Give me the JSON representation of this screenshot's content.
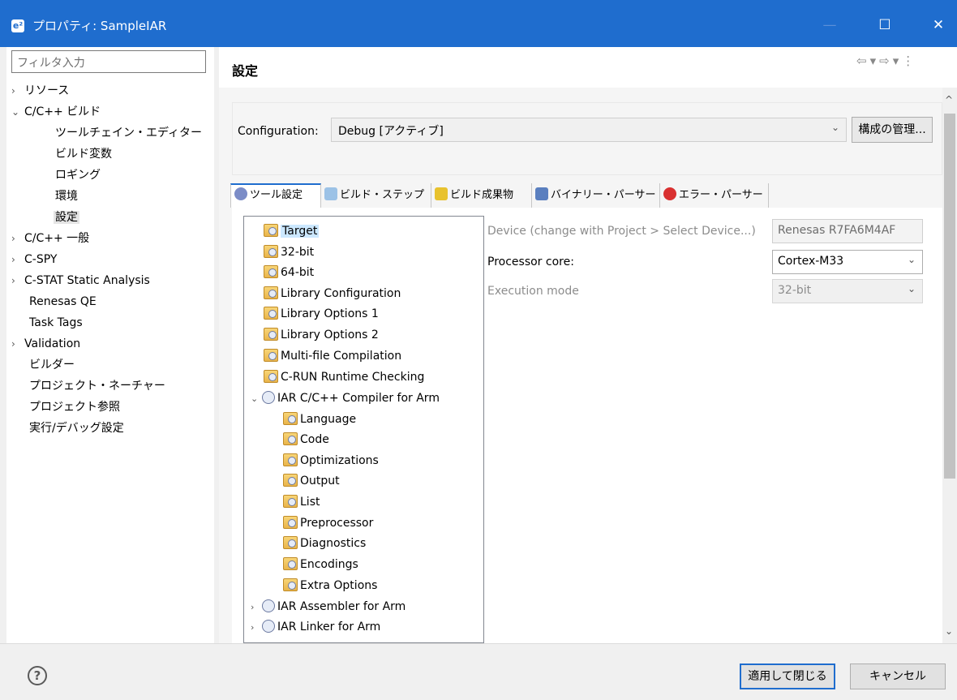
{
  "window": {
    "title": "プロパティ: SampleIAR",
    "app_icon": "e²",
    "minimize_icon": "—",
    "maximize_icon": "☐",
    "close_icon": "✕"
  },
  "filter": {
    "placeholder": "フィルタ入力"
  },
  "nav": {
    "items": [
      {
        "label": "リソース",
        "twisty": "›"
      },
      {
        "label": "C/C++ ビルド",
        "twisty": "⌄"
      },
      {
        "label": "ツールチェイン・エディター"
      },
      {
        "label": "ビルド変数"
      },
      {
        "label": "ロギング"
      },
      {
        "label": "環境"
      },
      {
        "label": "設定"
      },
      {
        "label": "C/C++ 一般",
        "twisty": "›"
      },
      {
        "label": "C-SPY",
        "twisty": "›"
      },
      {
        "label": "C-STAT Static Analysis",
        "twisty": "›"
      },
      {
        "label": "Renesas QE"
      },
      {
        "label": "Task Tags"
      },
      {
        "label": "Validation",
        "twisty": "›"
      },
      {
        "label": "ビルダー"
      },
      {
        "label": "プロジェクト・ネーチャー"
      },
      {
        "label": "プロジェクト参照"
      },
      {
        "label": "実行/デバッグ設定"
      }
    ]
  },
  "page": {
    "title": "設定",
    "back_icon": "⇦",
    "forward_icon": "⇨",
    "dropdown_icon": "▾",
    "menu_icon": "⋮"
  },
  "config": {
    "label": "Configuration:",
    "value": "Debug  [アクティブ]",
    "manage_label": "構成の管理..."
  },
  "tabs": [
    {
      "label": "ツール設定",
      "icon": "gear-icon",
      "color": "#7b8cc7"
    },
    {
      "label": "ビルド・ステップ",
      "icon": "wand-icon",
      "color": "#9cc2e6"
    },
    {
      "label": "ビルド成果物",
      "icon": "trophy-icon",
      "color": "#e8c22e"
    },
    {
      "label": "バイナリー・パーサー",
      "icon": "binary-icon",
      "color": "#5a7fbf"
    },
    {
      "label": "エラー・パーサー",
      "icon": "error-icon",
      "color": "#d93030"
    }
  ],
  "tool_tree": {
    "items": [
      {
        "label": "Target"
      },
      {
        "label": "32-bit"
      },
      {
        "label": "64-bit"
      },
      {
        "label": "Library Configuration"
      },
      {
        "label": "Library Options 1"
      },
      {
        "label": "Library Options 2"
      },
      {
        "label": "Multi-file Compilation"
      },
      {
        "label": "C-RUN Runtime Checking"
      },
      {
        "label": "IAR C/C++ Compiler for Arm",
        "twisty": "⌄"
      },
      {
        "label": "Language"
      },
      {
        "label": "Code"
      },
      {
        "label": "Optimizations"
      },
      {
        "label": "Output"
      },
      {
        "label": "List"
      },
      {
        "label": "Preprocessor"
      },
      {
        "label": "Diagnostics"
      },
      {
        "label": "Encodings"
      },
      {
        "label": "Extra Options"
      },
      {
        "label": "IAR Assembler for Arm",
        "twisty": "›"
      },
      {
        "label": "IAR Linker for Arm",
        "twisty": "›"
      }
    ]
  },
  "properties": {
    "device_label": "Device (change with Project > Select Device...)",
    "device_value": "Renesas R7FA6M4AF",
    "core_label": "Processor core:",
    "core_value": "Cortex-M33",
    "mode_label": "Execution mode",
    "mode_value": "32-bit"
  },
  "scroll": {
    "up": "^",
    "down": "⌄"
  },
  "footer": {
    "help_icon": "?",
    "apply_close_label": "適用して閉じる",
    "cancel_label": "キャンセル"
  },
  "colors": {
    "titlebar": "#1f6dce",
    "selection": "#cce8ff"
  }
}
